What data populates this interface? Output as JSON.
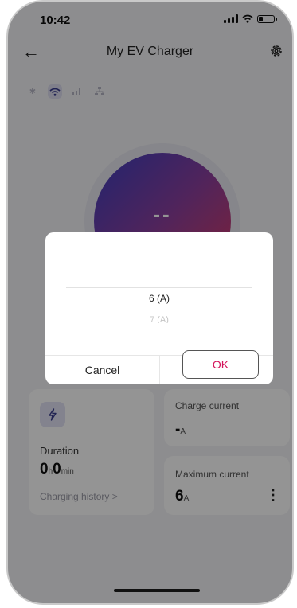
{
  "status_bar": {
    "time": "10:42"
  },
  "header": {
    "title": "My EV Charger",
    "back_icon": "arrow-left-icon",
    "settings_icon": "gear-icon"
  },
  "gauge": {
    "value": "--"
  },
  "duration_card": {
    "label": "Duration",
    "hours": "0",
    "hours_unit": "h",
    "minutes": "0",
    "minutes_unit": "min",
    "history_link": "Charging history >"
  },
  "charge_current_card": {
    "label": "Charge current",
    "value": "-",
    "unit": "A"
  },
  "max_current_card": {
    "label": "Maximum current",
    "value": "6",
    "unit": "A"
  },
  "dialog": {
    "selected_option": "6 (A)",
    "next_option": "7 (A)",
    "cancel_label": "Cancel",
    "ok_label": "OK"
  },
  "colors": {
    "accent": "#d4145a",
    "gauge_start": "#3b3fbf",
    "gauge_end": "#e03a5e"
  }
}
